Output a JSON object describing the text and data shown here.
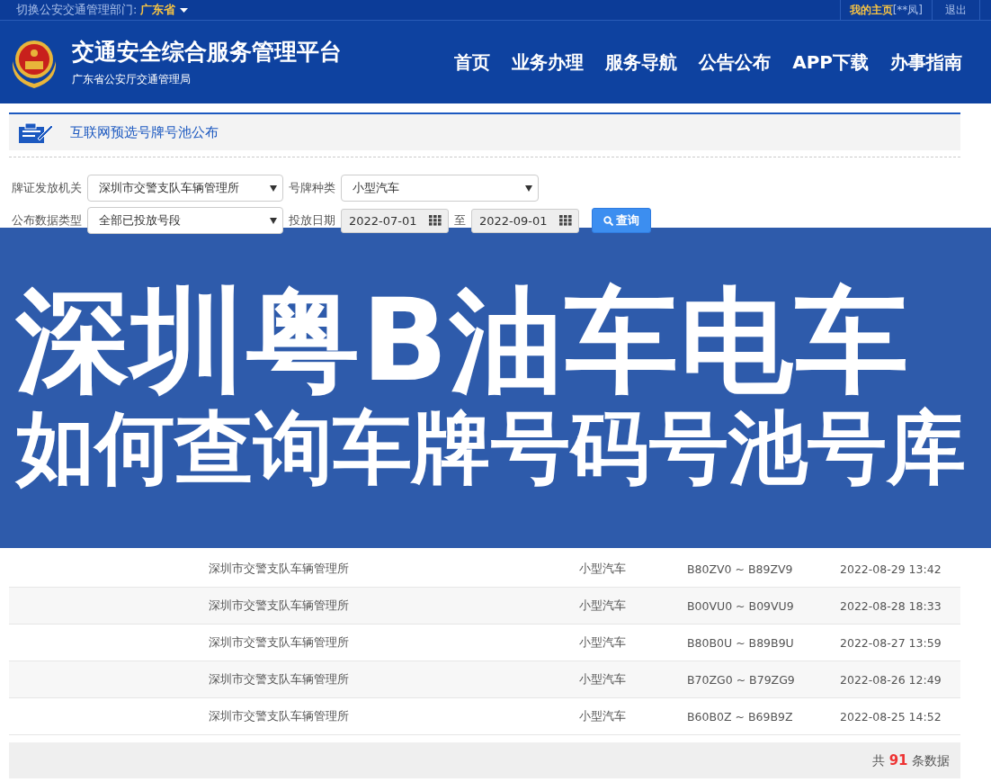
{
  "top_bar": {
    "switch_label": "切换公安交通管理部门:",
    "province": "广东省",
    "my_home": "我的主页",
    "user": "[**凤]",
    "logout": "退出"
  },
  "header": {
    "title": "交通安全综合服务管理平台",
    "subtitle": "广东省公安厅交通管理局",
    "nav": [
      {
        "label": "首页"
      },
      {
        "label": "业务办理"
      },
      {
        "label": "服务导航"
      },
      {
        "label": "公告公布"
      },
      {
        "label": "APP下载"
      },
      {
        "label": "办事指南"
      }
    ]
  },
  "section_title": "互联网预选号牌号池公布",
  "filters": {
    "issuer_label": "牌证发放机关",
    "issuer": "深圳市交警支队车辆管理所",
    "plate_type_label": "号牌种类",
    "plate_type": "小型汽车",
    "data_type_label": "公布数据类型",
    "data_type": "全部已投放号段",
    "date_label": "投放日期",
    "date_from": "2022-07-01",
    "date_sep": "至",
    "date_to": "2022-09-01",
    "query_button": "查询"
  },
  "banner": {
    "line_1": "深圳粤B油车电车",
    "line_2": "如何查询车牌号码号池号库"
  },
  "table": {
    "rows": [
      [
        "深圳市交警支队车辆管理所",
        "小型汽车",
        "B80ZV0 ~ B89ZV9",
        "2022-08-29 13:42"
      ],
      [
        "深圳市交警支队车辆管理所",
        "小型汽车",
        "B00VU0 ~ B09VU9",
        "2022-08-28 18:33"
      ],
      [
        "深圳市交警支队车辆管理所",
        "小型汽车",
        "B80B0U ~ B89B9U",
        "2022-08-27 13:59"
      ],
      [
        "深圳市交警支队车辆管理所",
        "小型汽车",
        "B70ZG0 ~ B79ZG9",
        "2022-08-26 12:49"
      ],
      [
        "深圳市交警支队车辆管理所",
        "小型汽车",
        "B60B0Z ~ B69B9Z",
        "2022-08-25 14:52"
      ]
    ]
  },
  "total": "共 **91** 条数据"
}
